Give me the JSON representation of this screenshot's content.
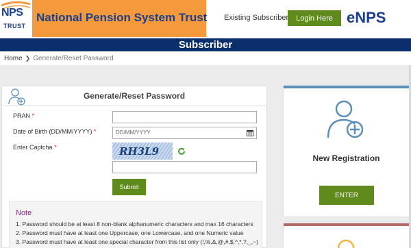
{
  "header": {
    "logo_text": "NPS",
    "logo_subtext": "TRUST",
    "site_title": "National Pension System Trust",
    "existing_label": "Existing Subscriber",
    "login_label": "Login Here",
    "brand": "eNPS"
  },
  "titlebar": {
    "title": "Subscriber"
  },
  "breadcrumb": {
    "home": "Home",
    "current": "Generate/Reset Password"
  },
  "form": {
    "title": "Generate/Reset Password",
    "pran_label": "PRAN",
    "dob_label": "Date of Birth (DD/MM/YYYY)",
    "dob_placeholder": "DD/MM/YYYY",
    "captcha_label": "Enter Captcha",
    "captcha_text": "RH3L9",
    "required_mark": "*",
    "submit_label": "Submit"
  },
  "note": {
    "title": "Note",
    "items": [
      "1.  Password should be at least 8 non-blank alphanumeric characters and max 16 characters",
      "2.  Password must have at least one Uppercase, one Lowercase, and one Numeric value",
      "3.  Password must have at least one special character from this list only (!,%,&,@,#,$,^,*,?,_,~)"
    ]
  },
  "side": {
    "new_registration_title": "New Registration",
    "enter_label": "ENTER"
  },
  "colors": {
    "orange": "#f59a3c",
    "navy": "#0b2e6d",
    "brand_blue": "#1b3f8b",
    "button_green": "#5f8a1c",
    "icon_blue": "#5b8fb9"
  }
}
